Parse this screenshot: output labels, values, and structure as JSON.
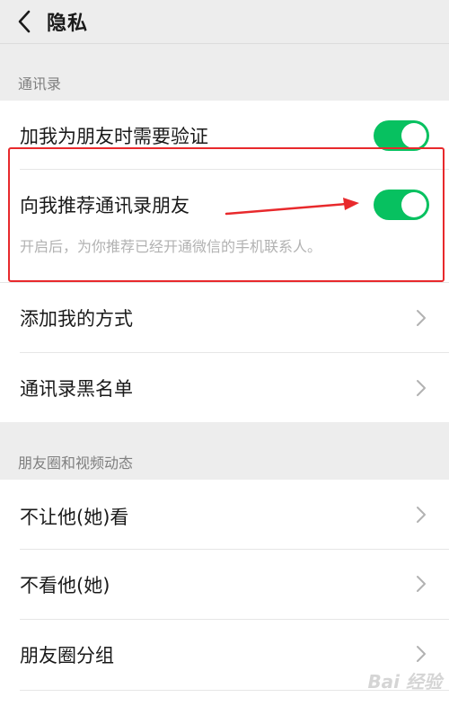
{
  "header": {
    "title": "隐私"
  },
  "sections": {
    "contacts": {
      "title": "通讯录",
      "items": {
        "verify": {
          "label": "加我为朋友时需要验证",
          "toggle_on": true
        },
        "recommend": {
          "label": "向我推荐通讯录朋友",
          "toggle_on": true,
          "desc": "开启后，为你推荐已经开通微信的手机联系人。"
        },
        "add_method": {
          "label": "添加我的方式"
        },
        "blacklist": {
          "label": "通讯录黑名单"
        }
      }
    },
    "moments": {
      "title": "朋友圈和视频动态",
      "items": {
        "hide_from": {
          "label": "不让他(她)看"
        },
        "dont_see": {
          "label": "不看他(她)"
        },
        "groups": {
          "label": "朋友圈分组"
        }
      }
    }
  },
  "watermark": {
    "text": "Bai 经验"
  },
  "colors": {
    "toggle_on": "#07c160",
    "highlight": "#e8292c",
    "background": "#ededed"
  },
  "icons": {
    "back": "chevron-left-icon",
    "row_arrow": "chevron-right-icon"
  }
}
